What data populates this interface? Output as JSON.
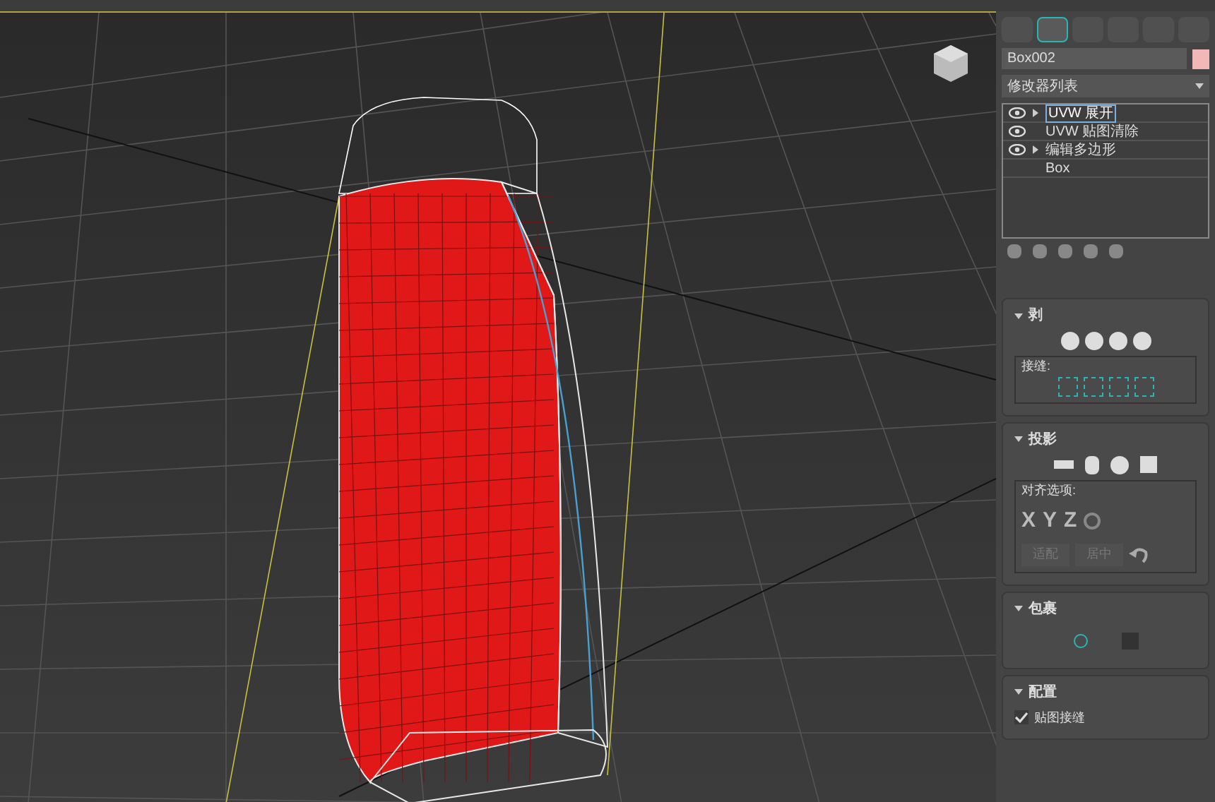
{
  "command_panel": {
    "object_name": "Box002",
    "modifier_list": "修改器列表",
    "stack": [
      {
        "label": "UVW 展开",
        "eye": true,
        "expander": true,
        "selected": true
      },
      {
        "label": "UVW 贴图清除",
        "eye": true,
        "expander": false,
        "selected": false
      },
      {
        "label": "编辑多边形",
        "eye": true,
        "expander": true,
        "selected": false
      },
      {
        "label": "Box",
        "eye": false,
        "expander": false,
        "selected": false
      }
    ]
  },
  "rollouts": {
    "peel": {
      "title": "剥",
      "seams_label": "接缝:"
    },
    "projection": {
      "title": "投影",
      "align_label": "对齐选项:",
      "axes": [
        "X",
        "Y",
        "Z"
      ],
      "buttons": [
        "适配",
        "居中"
      ]
    },
    "wrap": {
      "title": "包裹"
    },
    "config": {
      "title": "配置",
      "checkbox": {
        "label": "贴图接缝",
        "checked": true
      }
    }
  }
}
